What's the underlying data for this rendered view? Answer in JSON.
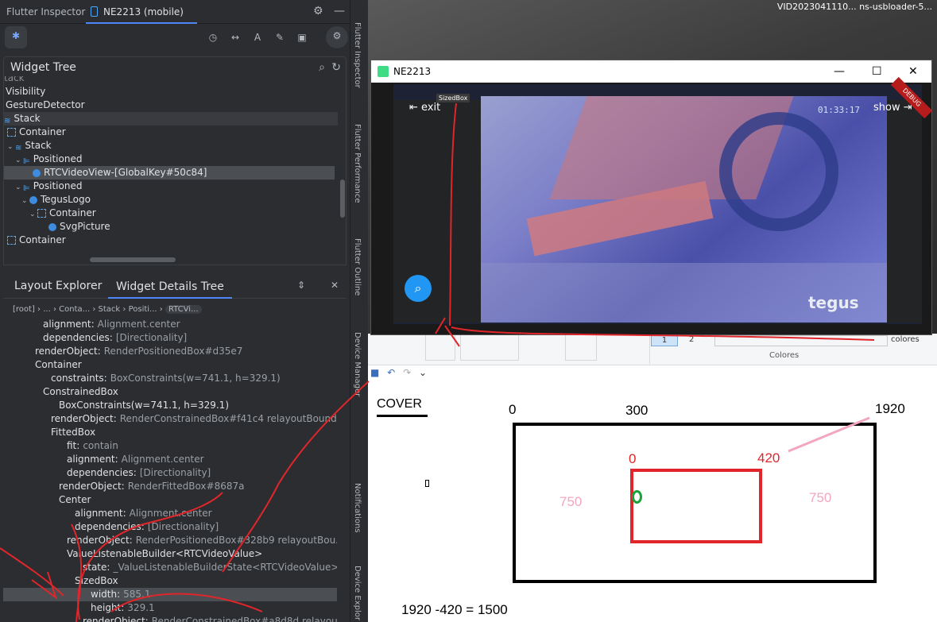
{
  "ide": {
    "tab_inspector": "Flutter Inspector",
    "tab_device": "NE2213 (mobile)",
    "widget_tree_title": "Widget Tree",
    "layout_explorer_tab": "Layout Explorer",
    "details_tree_tab": "Widget Details Tree",
    "tree_rows": [
      {
        "label": "tack",
        "indent": 0
      },
      {
        "label": "Visibility",
        "indent": 0
      },
      {
        "label": "GestureDetector",
        "indent": 0
      },
      {
        "label": "Stack",
        "indent": 0
      },
      {
        "label": "Container",
        "indent": 1
      },
      {
        "label": "Stack",
        "indent": 1
      },
      {
        "label": "Positioned",
        "indent": 2
      },
      {
        "label": "RTCVideoView-[GlobalKey#50c84]",
        "indent": 3
      },
      {
        "label": "Positioned",
        "indent": 2
      },
      {
        "label": "TegusLogo",
        "indent": 3
      },
      {
        "label": "Container",
        "indent": 4
      },
      {
        "label": "SvgPicture",
        "indent": 5
      },
      {
        "label": "Container",
        "indent": 0
      }
    ],
    "crumbs": [
      "[root]",
      "...",
      "Conta...",
      "Stack",
      "Positi...",
      "RTCVi..."
    ],
    "details": [
      {
        "key": "alignment:",
        "val": "Alignment.center",
        "indent": 4
      },
      {
        "key": "dependencies:",
        "val": "[Directionality]",
        "indent": 4
      },
      {
        "key": "renderObject:",
        "val": "RenderPositionedBox#d35e7",
        "indent": 3
      },
      {
        "key": "Container",
        "val": "",
        "indent": 3
      },
      {
        "key": "constraints:",
        "val": "BoxConstraints(w=741.1, h=329.1)",
        "indent": 5
      },
      {
        "key": "ConstrainedBox",
        "val": "",
        "indent": 4
      },
      {
        "key": "BoxConstraints(w=741.1, h=329.1)",
        "val": "",
        "indent": 6
      },
      {
        "key": "renderObject:",
        "val": "RenderConstrainedBox#f41c4 relayoutBounda...",
        "indent": 5
      },
      {
        "key": "FittedBox",
        "val": "",
        "indent": 5
      },
      {
        "key": "fit:",
        "val": "contain",
        "indent": 7
      },
      {
        "key": "alignment:",
        "val": "Alignment.center",
        "indent": 7
      },
      {
        "key": "dependencies:",
        "val": "[Directionality]",
        "indent": 7
      },
      {
        "key": "renderObject:",
        "val": "RenderFittedBox#8687a",
        "indent": 6
      },
      {
        "key": "Center",
        "val": "",
        "indent": 6
      },
      {
        "key": "alignment:",
        "val": "Alignment.center",
        "indent": 8
      },
      {
        "key": "dependencies:",
        "val": "[Directionality]",
        "indent": 8
      },
      {
        "key": "renderObject:",
        "val": "RenderPositionedBox#328b9 relayoutBou...",
        "indent": 7
      },
      {
        "key": "ValueListenableBuilder<RTCVideoValue>",
        "val": "",
        "indent": 7
      },
      {
        "key": "state:",
        "val": "_ValueListenableBuilderState<RTCVideoValue>...",
        "indent": 9
      },
      {
        "key": "SizedBox",
        "val": "",
        "indent": 8
      },
      {
        "key": "width:",
        "val": "585.1",
        "indent": 10
      },
      {
        "key": "height:",
        "val": "329.1",
        "indent": 10
      },
      {
        "key": "renderObject:",
        "val": "RenderConstrainedBox#a8d8d relayou...",
        "indent": 9
      }
    ]
  },
  "strip": {
    "flutter_inspector": "Flutter Inspector",
    "flutter_performance": "Flutter Performance",
    "flutter_outline": "Flutter Outline",
    "device_manager": "Device Manager",
    "notifications": "Notifications",
    "device_explorer": "Device Explor"
  },
  "desktop": {
    "top_right_text": "VID2023041110...  ns-usbloader-5..."
  },
  "emulator": {
    "title": "NE2213",
    "exit_label": "exit",
    "show_label": "show",
    "time": "01:33:17",
    "logo": "tegus",
    "debug": "DEBUG",
    "tooltip": "SizedBox"
  },
  "paint": {
    "colores_label": "colores",
    "colores_section": "Colores",
    "num1": "1",
    "num2": "2",
    "cover": "COVER",
    "n0_top": "0",
    "n300": "300",
    "n1920": "1920",
    "n0_inner": "0",
    "n420": "420",
    "n750_left": "750",
    "n750_right": "750",
    "equation": "1920 -420 = 1500"
  }
}
